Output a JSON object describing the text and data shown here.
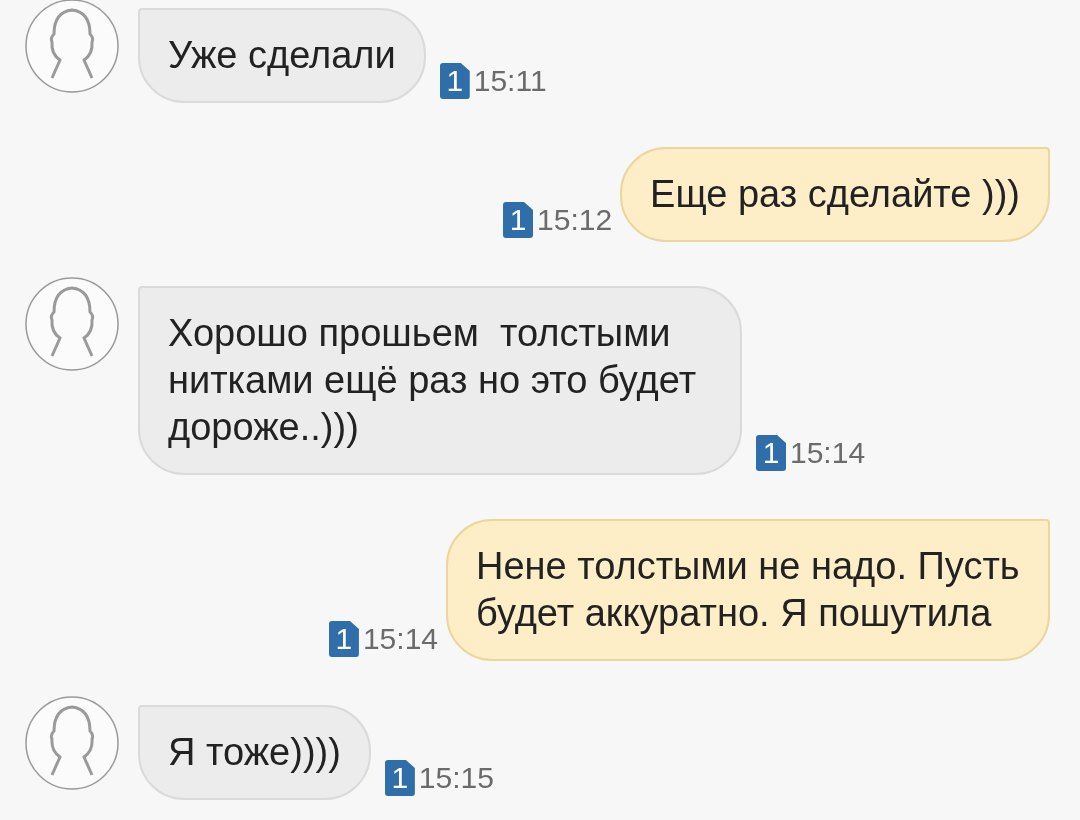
{
  "messages": [
    {
      "kind": "incoming",
      "text": "Уже сделали",
      "sim": "1",
      "time": "15:11"
    },
    {
      "kind": "outgoing",
      "text": "Еще раз сделайте )))",
      "sim": "1",
      "time": "15:12"
    },
    {
      "kind": "incoming",
      "text": "Хорошо прошьем  толстыми нитками ещё раз но это будет дороже..)))",
      "sim": "1",
      "time": "15:14"
    },
    {
      "kind": "outgoing",
      "text": "Нене толстыми не надо. Пусть будет аккуратно. Я пошутила",
      "sim": "1",
      "time": "15:14"
    },
    {
      "kind": "incoming",
      "text": "Я тоже))))",
      "sim": "1",
      "time": "15:15"
    }
  ]
}
